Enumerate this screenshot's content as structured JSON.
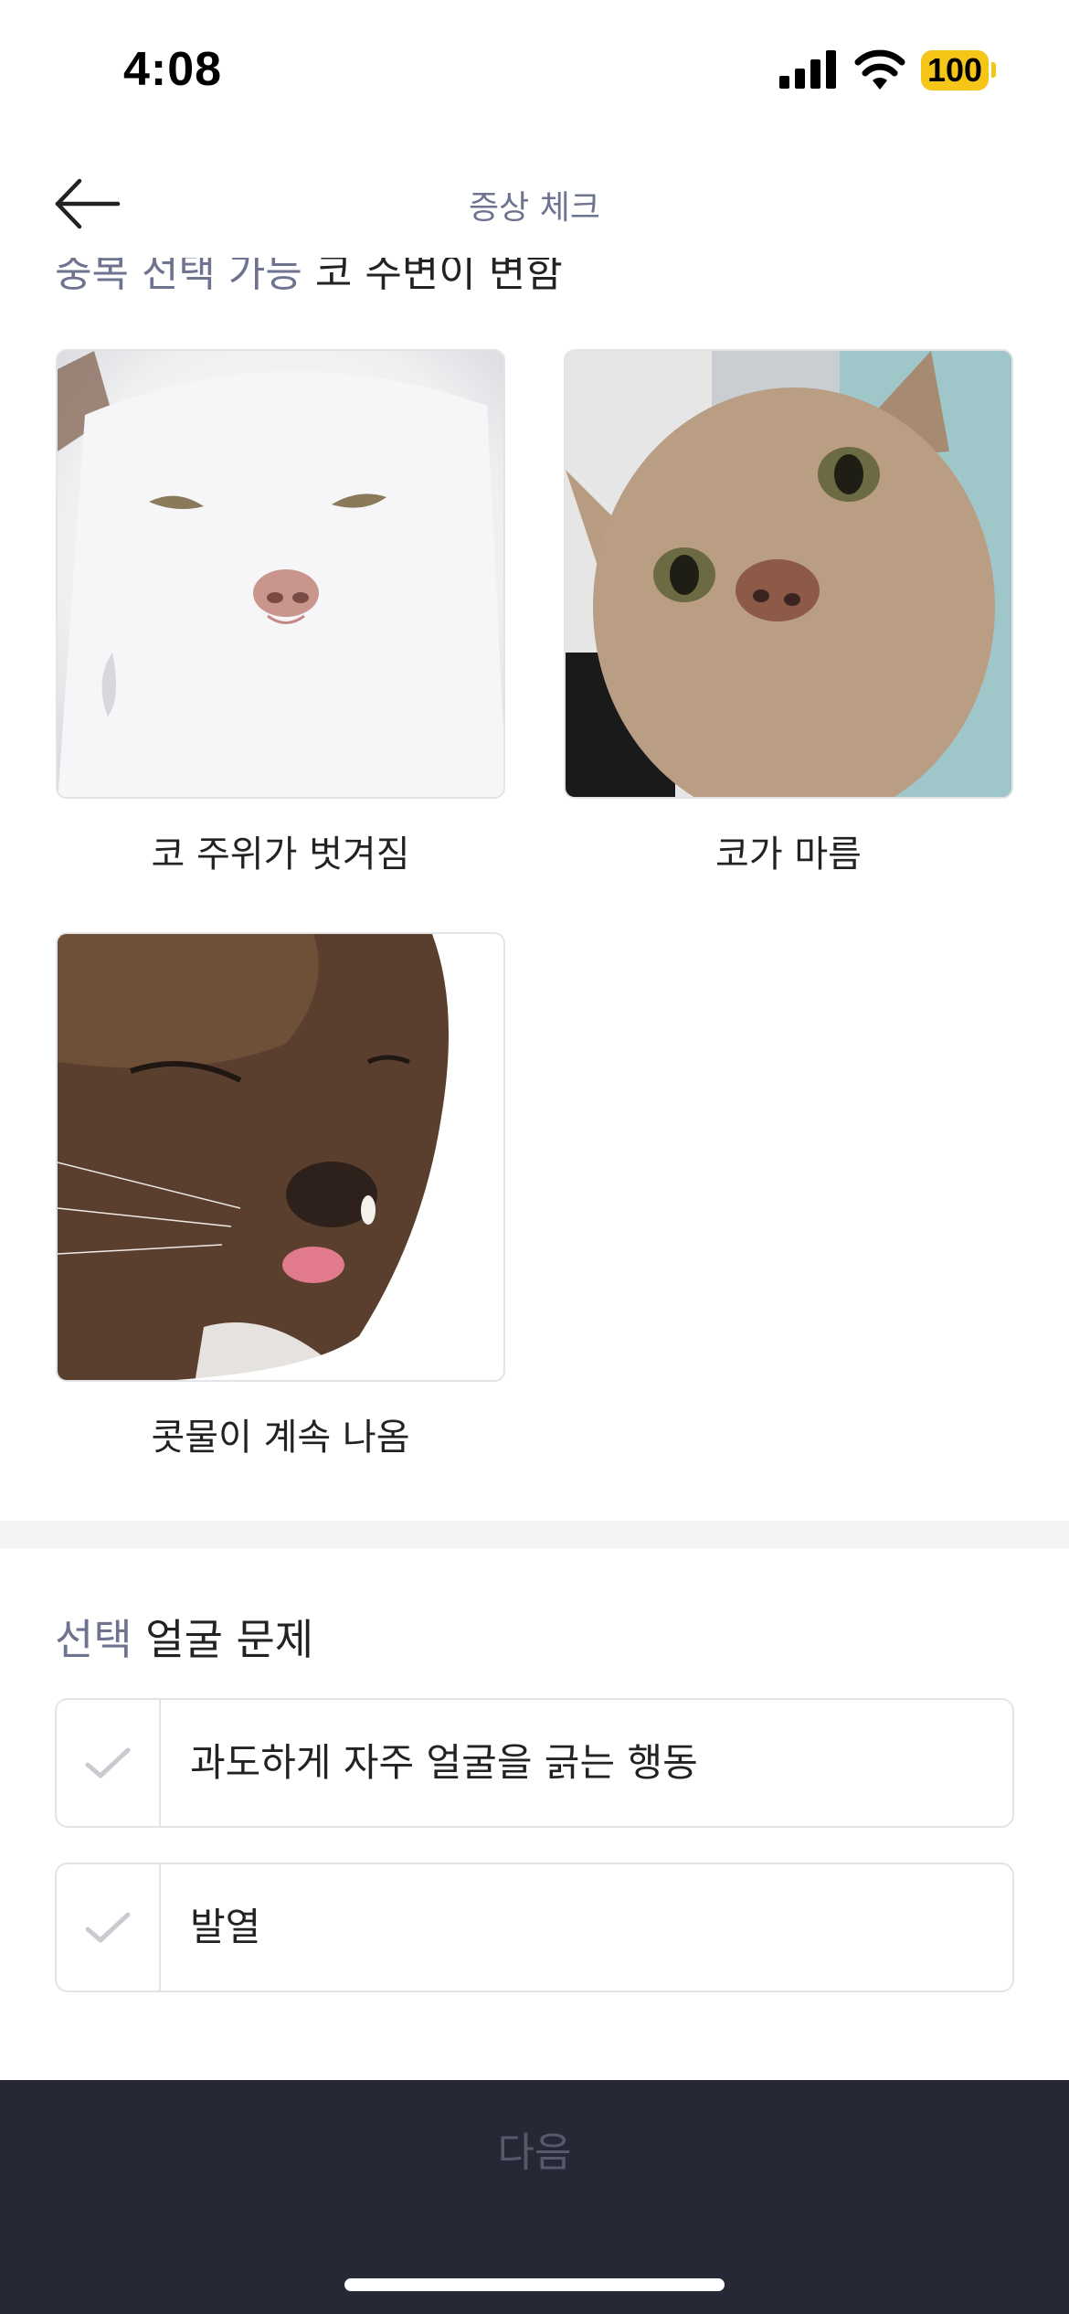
{
  "status_bar": {
    "time": "4:08",
    "battery": "100"
  },
  "header": {
    "title": "증상 체크"
  },
  "scroll_section": {
    "accent": "중복 선택 가능",
    "title": "코 주변이 변함"
  },
  "cards": [
    {
      "label": "코 주위가 벗겨짐",
      "icon": "white-cat-photo"
    },
    {
      "label": "코가 마름",
      "icon": "tan-cat-photo"
    },
    {
      "label": "콧물이 계속 나옴",
      "icon": "brown-cat-photo"
    }
  ],
  "section": {
    "accent": "선택",
    "title": "얼굴 문제",
    "options": [
      {
        "label": "과도하게 자주 얼굴을 긁는 행동"
      },
      {
        "label": "발열"
      }
    ]
  },
  "footer": {
    "next_label": "다음"
  },
  "colors": {
    "accent": "#6e7490",
    "bottom_bar": "#262835",
    "battery": "#f5c518"
  }
}
